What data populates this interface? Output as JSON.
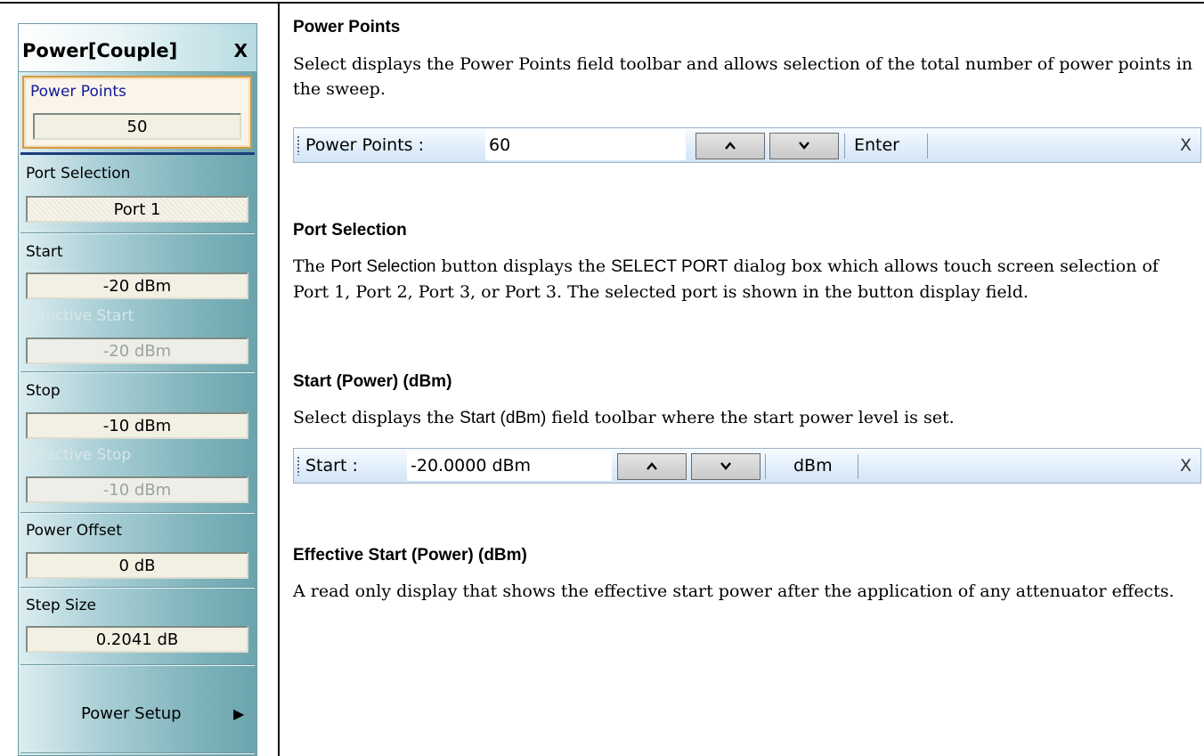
{
  "menu": {
    "title": "Power[Couple]",
    "close": "X",
    "selected_item": {
      "label": "Power Points",
      "value": "50"
    },
    "items": [
      {
        "label": "Port Selection",
        "value": "Port 1"
      },
      {
        "label": "Start",
        "value": "-20  dBm"
      },
      {
        "label": "Effective Start",
        "value": "-20  dBm"
      },
      {
        "label": "Stop",
        "value": "-10  dBm"
      },
      {
        "label": "Effective Stop",
        "value": "-10  dBm"
      },
      {
        "label": "Power Offset",
        "value": "0  dB"
      },
      {
        "label": "Step Size",
        "value": "0.2041  dB"
      }
    ],
    "submenu": "Power Setup",
    "submenu_arrow": "▶"
  },
  "sections": {
    "power_points": {
      "heading": "Power Points",
      "body": "Select displays the Power Points field toolbar and allows selection of the total number of power points in the sweep.",
      "toolbar": {
        "label": "Power Points  :",
        "value": "60",
        "action": "Enter",
        "close": "X"
      }
    },
    "port_selection": {
      "heading": "Port Selection",
      "body_prefix": "The ",
      "button_name": "Port Selection",
      "body_middle": " button displays the ",
      "dialog_name": "SELECT PORT",
      "body_suffix": " dialog box which allows touch screen selection of Port 1, Port 2, Port 3, or Port 3. The selected port is shown in the button display field."
    },
    "start": {
      "heading": "Start (Power) (dBm)",
      "body_prefix": "Select displays the ",
      "field_name": "Start (dBm)",
      "body_suffix": " field toolbar where the start power level is set.",
      "toolbar": {
        "label": "Start  :",
        "value": "-20.0000  dBm",
        "unit": "dBm",
        "close": "X"
      }
    },
    "effective_start": {
      "heading": "Effective Start (Power) (dBm)",
      "body": "A read only display that shows the effective start power after the application of any attenuator effects."
    }
  }
}
